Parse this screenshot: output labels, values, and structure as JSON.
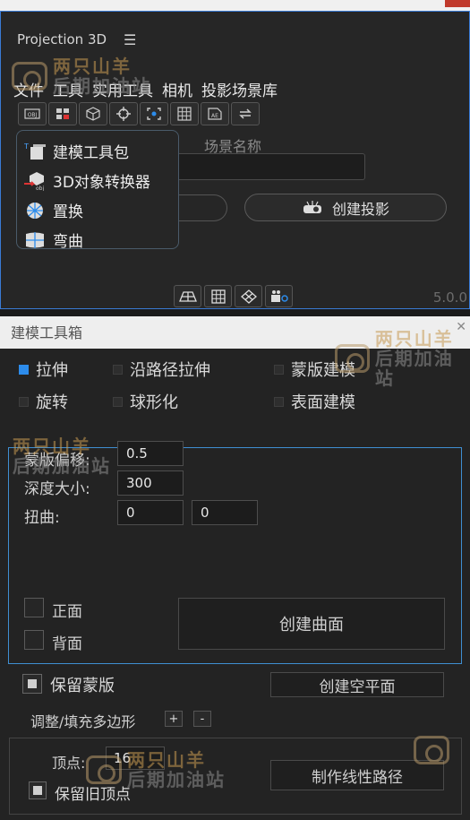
{
  "panel_top": {
    "title": "Projection 3D",
    "menu": [
      "文件",
      "工具",
      "实用工具",
      "相机",
      "投影场景库"
    ],
    "scene_name_label": "场景名称",
    "create_projection": "创建投影",
    "version": "5.0.0",
    "dropdown": [
      "建模工具包",
      "3D对象转换器",
      "置换",
      "弯曲"
    ]
  },
  "panel_toolbox": {
    "title": "建模工具箱",
    "modes": [
      {
        "label": "拉伸",
        "checked": true
      },
      {
        "label": "沿路径拉伸",
        "checked": false
      },
      {
        "label": "蒙版建模",
        "checked": false
      },
      {
        "label": "旋转",
        "checked": false
      },
      {
        "label": "球形化",
        "checked": false
      },
      {
        "label": "表面建模",
        "checked": false
      }
    ],
    "mask_offset_label": "蒙版偏移:",
    "mask_offset_value": "0.5",
    "depth_label": "深度大小:",
    "depth_value": "300",
    "twist_label": "扭曲:",
    "twist_value_1": "0",
    "twist_value_2": "0",
    "front_label": "正面",
    "back_label": "背面",
    "create_surface": "创建曲面",
    "keep_mask_label": "保留蒙版",
    "create_empty_plane": "创建空平面",
    "adjust_polygon_label": "调整/填充多边形",
    "plus": "+",
    "minus": "-",
    "vertex_label": "顶点:",
    "vertex_value": "16",
    "keep_old_vertex_label": "保留旧顶点",
    "make_linear_path": "制作线性路径"
  },
  "watermark": {
    "line1": "两只山羊",
    "line2": "后期加油站"
  }
}
